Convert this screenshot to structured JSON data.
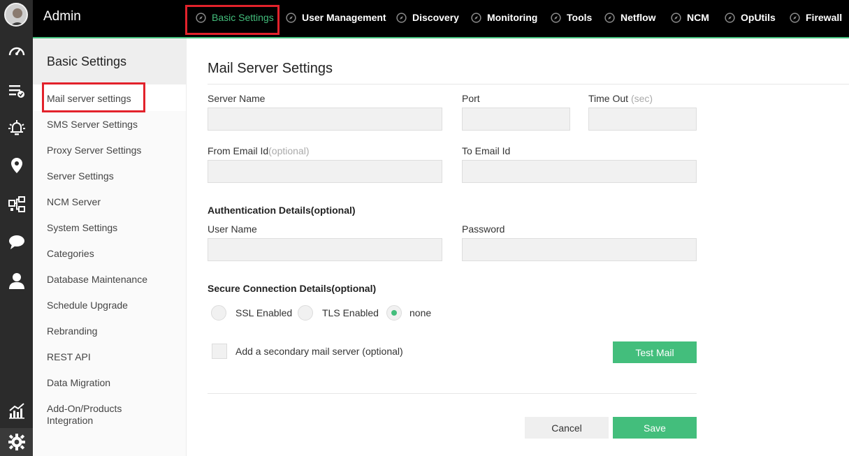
{
  "app": {
    "title": "Admin"
  },
  "topnav": {
    "items": [
      {
        "label": "Basic Settings",
        "active": true
      },
      {
        "label": "User Management"
      },
      {
        "label": "Discovery"
      },
      {
        "label": "Monitoring"
      },
      {
        "label": "Tools"
      },
      {
        "label": "Netflow"
      },
      {
        "label": "NCM"
      },
      {
        "label": "OpUtils"
      },
      {
        "label": "Firewall"
      }
    ],
    "highlight_color": "#e2222b",
    "accent_color": "#43be7c"
  },
  "rail": {
    "icons": [
      "avatar",
      "dashboard-gauge-icon",
      "inventory-list-icon",
      "alarms-bell-icon",
      "maps-pin-icon",
      "network-topology-icon",
      "chat-icon",
      "user-icon",
      "reports-chart-icon",
      "settings-gear-icon"
    ]
  },
  "sidebar": {
    "title": "Basic Settings",
    "items": [
      {
        "label": "Mail server settings",
        "active": true
      },
      {
        "label": "SMS Server Settings"
      },
      {
        "label": "Proxy Server Settings"
      },
      {
        "label": "Server Settings"
      },
      {
        "label": "NCM Server"
      },
      {
        "label": "System Settings"
      },
      {
        "label": "Categories"
      },
      {
        "label": "Database Maintenance"
      },
      {
        "label": "Schedule Upgrade"
      },
      {
        "label": "Rebranding"
      },
      {
        "label": "REST API"
      },
      {
        "label": "Data Migration"
      },
      {
        "label": "Add-On/Products Integration"
      }
    ]
  },
  "form": {
    "title": "Mail Server Settings",
    "server_name_label": "Server Name",
    "server_name_value": "",
    "port_label": "Port",
    "port_value": "",
    "timeout_label": "Time Out",
    "timeout_unit": "(sec)",
    "timeout_value": "",
    "from_email_label": "From Email Id",
    "from_email_hint": "(optional)",
    "from_email_value": "",
    "to_email_label": "To Email Id",
    "to_email_value": "",
    "auth_section": "Authentication Details(optional)",
    "username_label": "User Name",
    "username_value": "",
    "password_label": "Password",
    "password_value": "",
    "secure_section": "Secure Connection Details(optional)",
    "secure_options": [
      {
        "label": "SSL Enabled",
        "checked": false
      },
      {
        "label": "TLS Enabled",
        "checked": false
      },
      {
        "label": "none",
        "checked": true
      }
    ],
    "secondary_label": "Add a secondary mail server (optional)",
    "secondary_checked": false,
    "test_mail_label": "Test Mail",
    "cancel_label": "Cancel",
    "save_label": "Save"
  }
}
